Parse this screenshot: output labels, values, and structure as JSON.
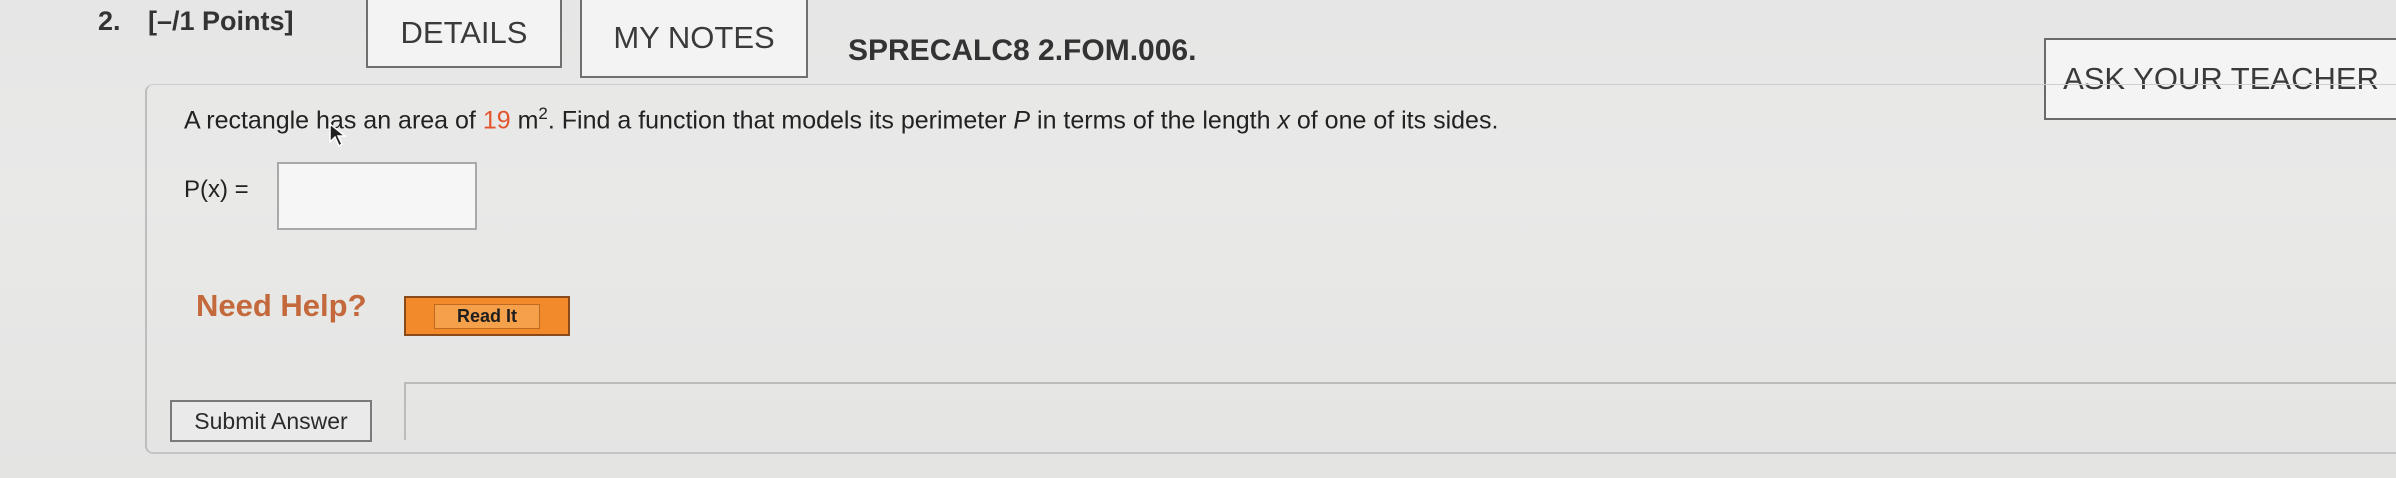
{
  "header": {
    "question_number": "2.",
    "points": "[–/1 Points]",
    "details_label": "DETAILS",
    "my_notes_label": "MY NOTES",
    "problem_code": "SPRECALC8 2.FOM.006.",
    "ask_teacher_label": "ASK YOUR TEACHER"
  },
  "question": {
    "text_before": "A rectangle has an area of ",
    "area_value": "19",
    "unit": " m",
    "unit_exponent": "2",
    "text_middle": ". Find a function that models its perimeter ",
    "perimeter_var": "P",
    "text_mid2": " in terms of the length ",
    "length_var": "x",
    "text_after": " of one of its sides.",
    "function_label": "P(x) =",
    "answer_value": ""
  },
  "help": {
    "need_help_label": "Need Help?",
    "read_it_label": "Read It"
  },
  "actions": {
    "submit_label": "Submit Answer"
  },
  "colors": {
    "value_highlight": "#e2562d",
    "need_help": "#c4693b",
    "read_it_button": "#f28a2b"
  }
}
